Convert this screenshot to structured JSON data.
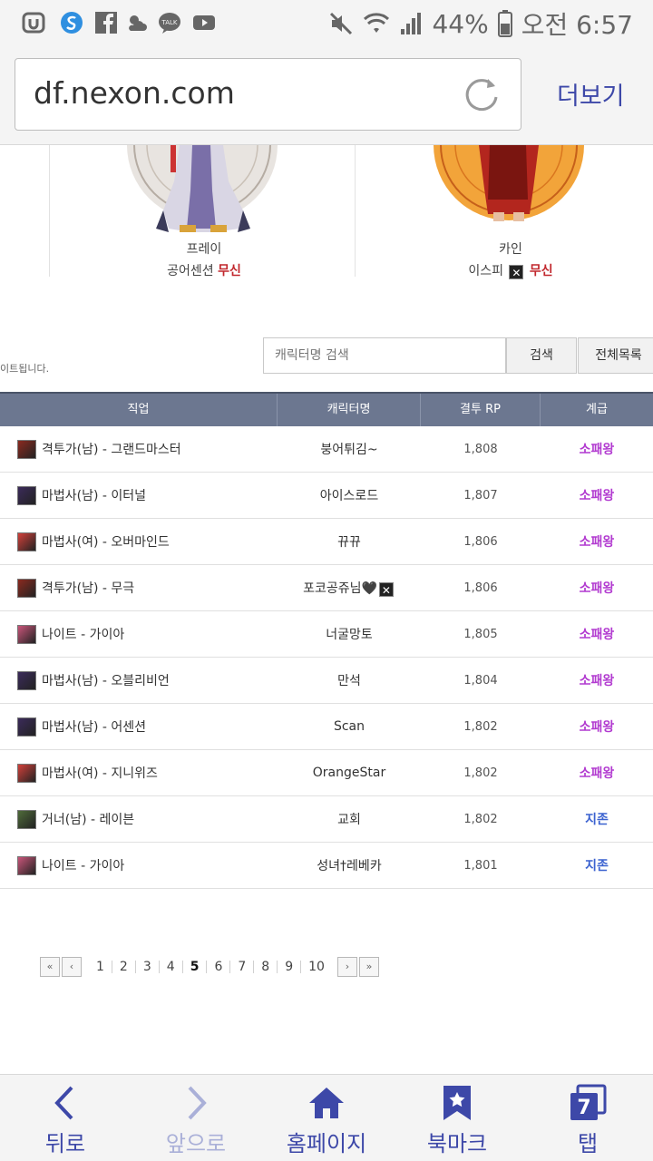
{
  "status_bar": {
    "battery": "44%",
    "time": "오전 6:57"
  },
  "browser": {
    "url": "df.nexon.com",
    "more_label": "더보기"
  },
  "top_characters": [
    {
      "name": "프레이",
      "server": "공어센션",
      "tier": "무신"
    },
    {
      "name": "카인",
      "server": "이스피",
      "tier": "무신"
    }
  ],
  "search": {
    "notice": "이트됩니다.",
    "placeholder": "캐릭터명 검색",
    "search_button": "검색",
    "all_button": "전체목록"
  },
  "table": {
    "headers": [
      "직업",
      "캐릭터명",
      "결투 RP",
      "계급"
    ],
    "rows": [
      {
        "job": "격투가(남) - 그랜드마스터",
        "name": "붕어튀김~",
        "rp": "1,808",
        "tier": "소패왕",
        "tier_color": "purple",
        "icon_color": "#8b2a1f"
      },
      {
        "job": "마법사(남) - 이터널",
        "name": "아이스로드",
        "rp": "1,807",
        "tier": "소패왕",
        "tier_color": "purple",
        "icon_color": "#3b2b5a"
      },
      {
        "job": "마법사(여) - 오버마인드",
        "name": "뀨뀨",
        "rp": "1,806",
        "tier": "소패왕",
        "tier_color": "purple",
        "icon_color": "#d2403a"
      },
      {
        "job": "격투가(남) - 무극",
        "name": "포코공쥬님🖤",
        "rp": "1,806",
        "tier": "소패왕",
        "tier_color": "purple",
        "icon_color": "#8b2a1f"
      },
      {
        "job": "나이트 - 가이아",
        "name": "너굴망토",
        "rp": "1,805",
        "tier": "소패왕",
        "tier_color": "purple",
        "icon_color": "#c9557a"
      },
      {
        "job": "마법사(남) - 오블리비언",
        "name": "만석",
        "rp": "1,804",
        "tier": "소패왕",
        "tier_color": "purple",
        "icon_color": "#3b2b5a"
      },
      {
        "job": "마법사(남) - 어센션",
        "name": "Scan",
        "rp": "1,802",
        "tier": "소패왕",
        "tier_color": "purple",
        "icon_color": "#3b2b5a"
      },
      {
        "job": "마법사(여) - 지니위즈",
        "name": "OrangeStar",
        "rp": "1,802",
        "tier": "소패왕",
        "tier_color": "purple",
        "icon_color": "#d2403a"
      },
      {
        "job": "거너(남) - 레이븐",
        "name": "교회",
        "rp": "1,802",
        "tier": "지존",
        "tier_color": "blue",
        "icon_color": "#4f6b3a"
      },
      {
        "job": "나이트 - 가이아",
        "name": "성녀†레베카",
        "rp": "1,801",
        "tier": "지존",
        "tier_color": "blue",
        "icon_color": "#c9557a"
      }
    ]
  },
  "pagination": {
    "first": "«",
    "prev": "‹",
    "pages": [
      "1",
      "2",
      "3",
      "4",
      "5",
      "6",
      "7",
      "8",
      "9",
      "10"
    ],
    "current": "5",
    "next": "›",
    "last": "»"
  },
  "bottom_nav": [
    {
      "label": "뒤로",
      "icon": "chevron-left-icon",
      "enabled": true
    },
    {
      "label": "앞으로",
      "icon": "chevron-right-icon",
      "enabled": false
    },
    {
      "label": "홈페이지",
      "icon": "home-icon",
      "enabled": true
    },
    {
      "label": "북마크",
      "icon": "bookmark-icon",
      "enabled": true
    },
    {
      "label": "탭",
      "icon": "tabs-icon",
      "enabled": true,
      "count": "7"
    }
  ],
  "colors": {
    "accent": "#3d48a8",
    "table_header": "#6c7790",
    "tier_purple": "#b23bd0",
    "tier_blue": "#3b62d0",
    "mu_red": "#c1272d"
  }
}
